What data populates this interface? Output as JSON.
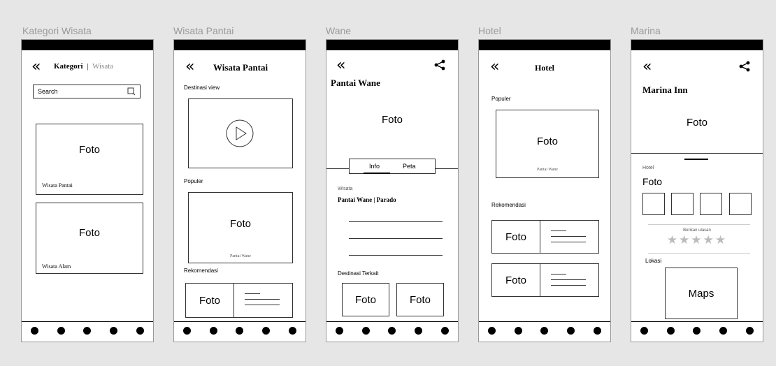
{
  "frames": {
    "kategori": {
      "label": "Kategori Wisata",
      "title_main": "Kategori",
      "title_sep": "|",
      "title_sub": "Wisata",
      "search_placeholder": "Search",
      "cards": [
        {
          "photo": "Foto",
          "caption": "Wisata Pantai"
        },
        {
          "photo": "Foto",
          "caption": "Wisata Alam"
        }
      ]
    },
    "pantai": {
      "label": "Wisata Pantai",
      "title": "Wisata Pantai",
      "section_destinasi": "Destinasi view",
      "section_populer": "Populer",
      "populer_photo": "Foto",
      "populer_caption": "Pantai Wane",
      "section_rekomendasi": "Rekomendasi",
      "rekomendasi_photo": "Foto"
    },
    "wane": {
      "label": "Wane",
      "title": "Pantai Wane",
      "photo": "Foto",
      "tabs": [
        "Info",
        "Peta"
      ],
      "category": "Wisata",
      "subtitle": "Pantai Wane | Parado",
      "section_terkait": "Destinasi Terkait",
      "related": [
        "Foto",
        "Foto"
      ]
    },
    "hotel": {
      "label": "Hotel",
      "title": "Hotel",
      "section_populer": "Populer",
      "populer_photo": "Foto",
      "populer_caption": "Pantai Wane",
      "section_rekomendasi": "Rekomendasi",
      "rekomendasi": [
        "Foto",
        "Foto"
      ]
    },
    "marina": {
      "label": "Marina",
      "title": "Marina Inn",
      "photo": "Foto",
      "category": "Hotel",
      "gallery_title": "Foto",
      "review_label": "Berikan ulasan",
      "stars": "★★★★★",
      "section_lokasi": "Lokasi",
      "maps": "Maps"
    }
  },
  "icons": {
    "back": "«",
    "search": "search-icon",
    "share": "share-icon",
    "play": "play-icon"
  }
}
